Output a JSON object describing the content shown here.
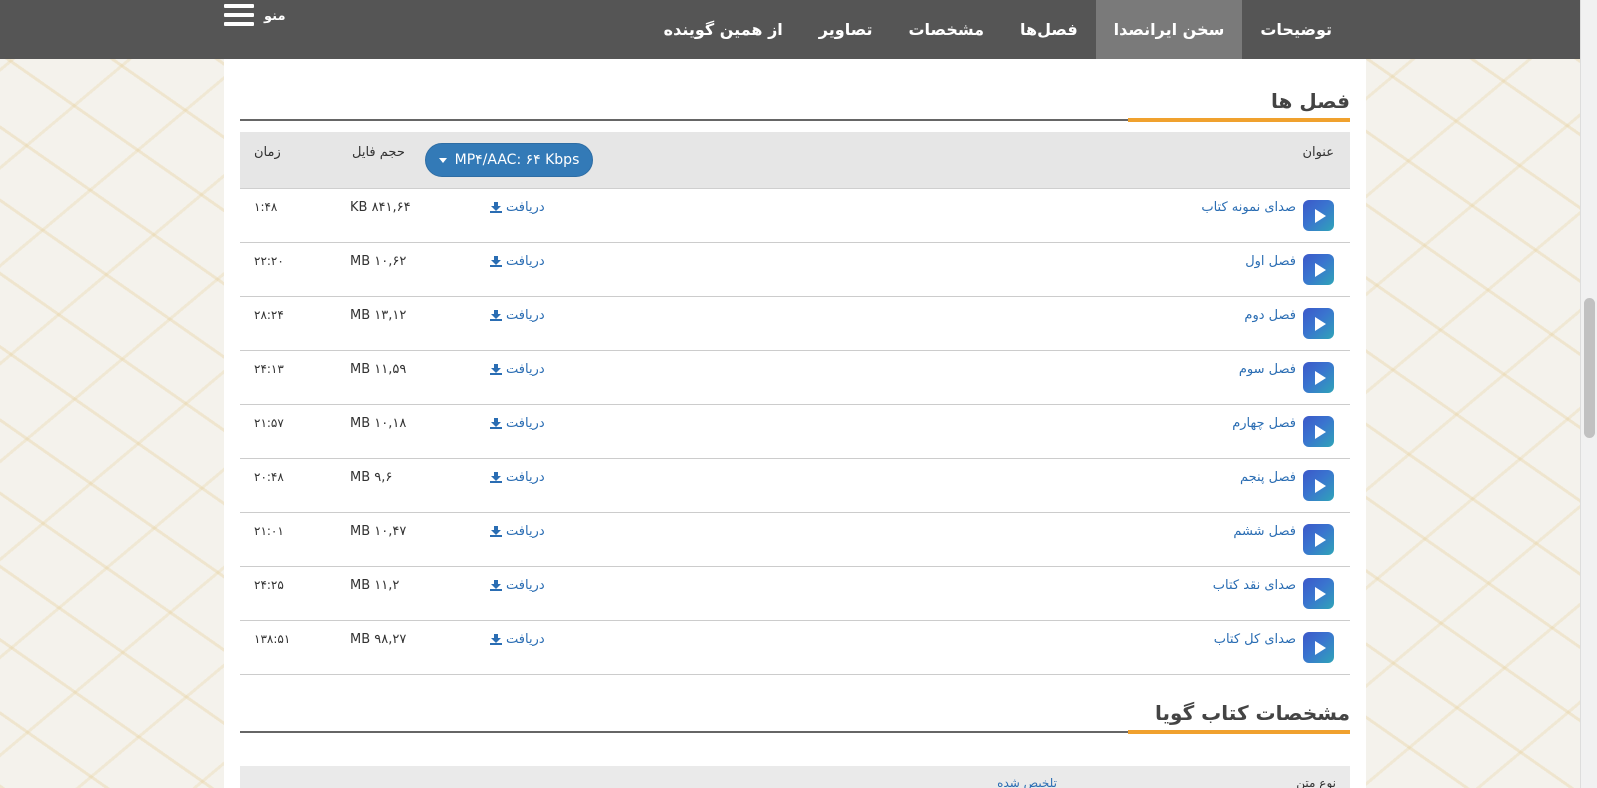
{
  "nav": {
    "items": [
      {
        "label": "توضیحات",
        "active": false
      },
      {
        "label": "سخن ایرانصدا",
        "active": true
      },
      {
        "label": "فصل‌ها",
        "active": false
      },
      {
        "label": "مشخصات",
        "active": false
      },
      {
        "label": "تصاویر",
        "active": false
      },
      {
        "label": "از همین گوینده",
        "active": false
      }
    ],
    "menu_label": "منو"
  },
  "chapters": {
    "title": "فصل ها",
    "columns": {
      "title": "عنوان",
      "size": "حجم فایل",
      "time": "زمان"
    },
    "format": "MP۴/AAC: ۶۴ Kbps",
    "download_label": "دریافت",
    "rows": [
      {
        "title": "صدای نمونه کتاب",
        "size": "KB ۸۴۱,۶۴",
        "time": "۱:۴۸"
      },
      {
        "title": "فصل اول",
        "size": "MB ۱۰,۶۲",
        "time": "۲۲:۲۰"
      },
      {
        "title": "فصل دوم",
        "size": "MB ۱۳,۱۲",
        "time": "۲۸:۲۴"
      },
      {
        "title": "فصل سوم",
        "size": "MB ۱۱,۵۹",
        "time": "۲۴:۱۳"
      },
      {
        "title": "فصل چهارم",
        "size": "MB ۱۰,۱۸",
        "time": "۲۱:۵۷"
      },
      {
        "title": "فصل پنجم",
        "size": "MB ۹,۶",
        "time": "۲۰:۴۸"
      },
      {
        "title": "فصل ششم",
        "size": "MB ۱۰,۴۷",
        "time": "۲۱:۰۱"
      },
      {
        "title": "صدای نقد کتاب",
        "size": "MB ۱۱,۲",
        "time": "۲۴:۲۵"
      },
      {
        "title": "صدای کل کتاب",
        "size": "MB ۹۸,۲۷",
        "time": "۱۳۸:۵۱"
      }
    ]
  },
  "specs": {
    "title": "مشخصات کتاب گویا",
    "row_label": "نوع متن",
    "row_value": "تلخیص شده"
  },
  "colors": {
    "accent": "#f0a12e",
    "link": "#2a6db3",
    "nav_bg": "#555555",
    "button": "#337ab7"
  }
}
